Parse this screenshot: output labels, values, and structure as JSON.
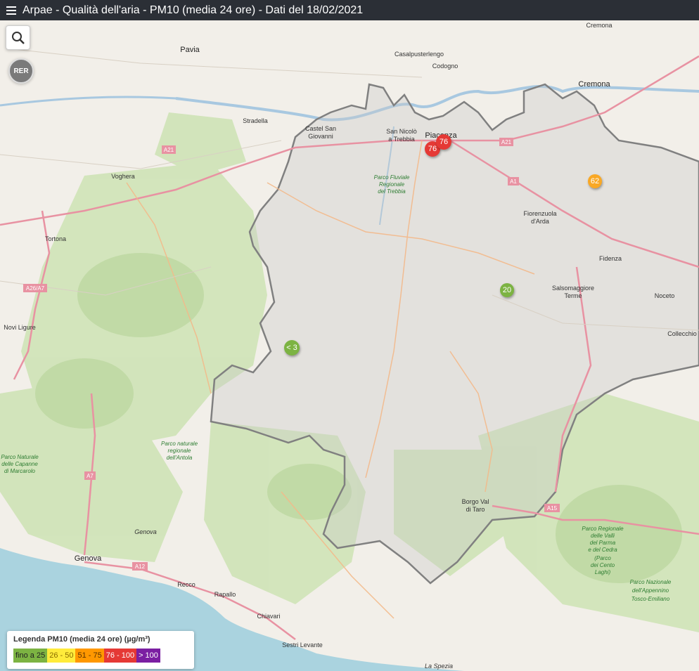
{
  "header": {
    "title": "Arpae - Qualità dell'aria - PM10 (media 24 ore) - Dati del 18/02/2021"
  },
  "controls": {
    "rer_label": "RER"
  },
  "markers": [
    {
      "value": "76",
      "color": "#e53935"
    },
    {
      "value": "76",
      "color": "#e53935"
    },
    {
      "value": "62",
      "color": "#f9a825"
    },
    {
      "value": "20",
      "color": "#7cb342"
    },
    {
      "value": "< 3",
      "color": "#7cb342"
    }
  ],
  "places": {
    "pavia": "Pavia",
    "cremona": "Cremona",
    "cremona_top": "Cremona",
    "casalpusterlengo": "Casalpusterlengo",
    "codogno": "Codogno",
    "stradella": "Stradella",
    "castel": "Castel San",
    "giovanni": "Giovanni",
    "san_nicolo": "San Nicolò",
    "a_trebbia": "a Trebbia",
    "piacenza": "Piacenza",
    "voghera": "Voghera",
    "tortona": "Tortona",
    "fiorenzuola": "Fiorenzuola",
    "darda": "d'Arda",
    "fidenza": "Fidenza",
    "salsomaggiore": "Salsomaggiore",
    "terme": "Terme",
    "noceto": "Noceto",
    "collecchio": "Collecchio",
    "novi_ligure": "Novi Ligure",
    "genova": "Genova",
    "genova_small": "Genova",
    "recco": "Recco",
    "rapallo": "Rapallo",
    "chiavari": "Chiavari",
    "sestri": "Sestri Levante",
    "la_spezia": "La Spezia",
    "borgo": "Borgo Val",
    "di_taro": "di Taro"
  },
  "roads": {
    "a21a": "A21",
    "a21b": "A21",
    "a1": "A1",
    "a26": "A26/A7",
    "a7": "A7",
    "a12": "A12",
    "a15": "A15"
  },
  "parks": {
    "trebbia_1": "Parco Fluviale",
    "trebbia_2": "Regionale",
    "trebbia_3": "del Trebbia",
    "antola_1": "Parco naturale",
    "antola_2": "regionale",
    "antola_3": "dell'Antola",
    "capanne_1": "Parco Naturale",
    "capanne_2": "delle Capanne",
    "capanne_3": "di Marcarolo",
    "parma_1": "Parco Regionale",
    "parma_2": "delle Valli",
    "parma_3": "del Parma",
    "parma_4": "e del Cedra",
    "parma_5": "(Parco",
    "parma_6": "dei Cento",
    "parma_7": "Laghi)",
    "appennino_1": "Parco Nazionale",
    "appennino_2": "dell'Appennino",
    "appennino_3": "Tosco-Emiliano"
  },
  "legend": {
    "title": "Legenda PM10 (media 24 ore) (µg/m³)",
    "items": [
      {
        "label": "fino a 25",
        "color": "#7cb342"
      },
      {
        "label": "26 - 50",
        "color": "#ffeb3b"
      },
      {
        "label": "51 - 75",
        "color": "#ff9800"
      },
      {
        "label": "76 - 100",
        "color": "#e53935"
      },
      {
        "label": "> 100",
        "color": "#7b1fa2"
      }
    ]
  }
}
